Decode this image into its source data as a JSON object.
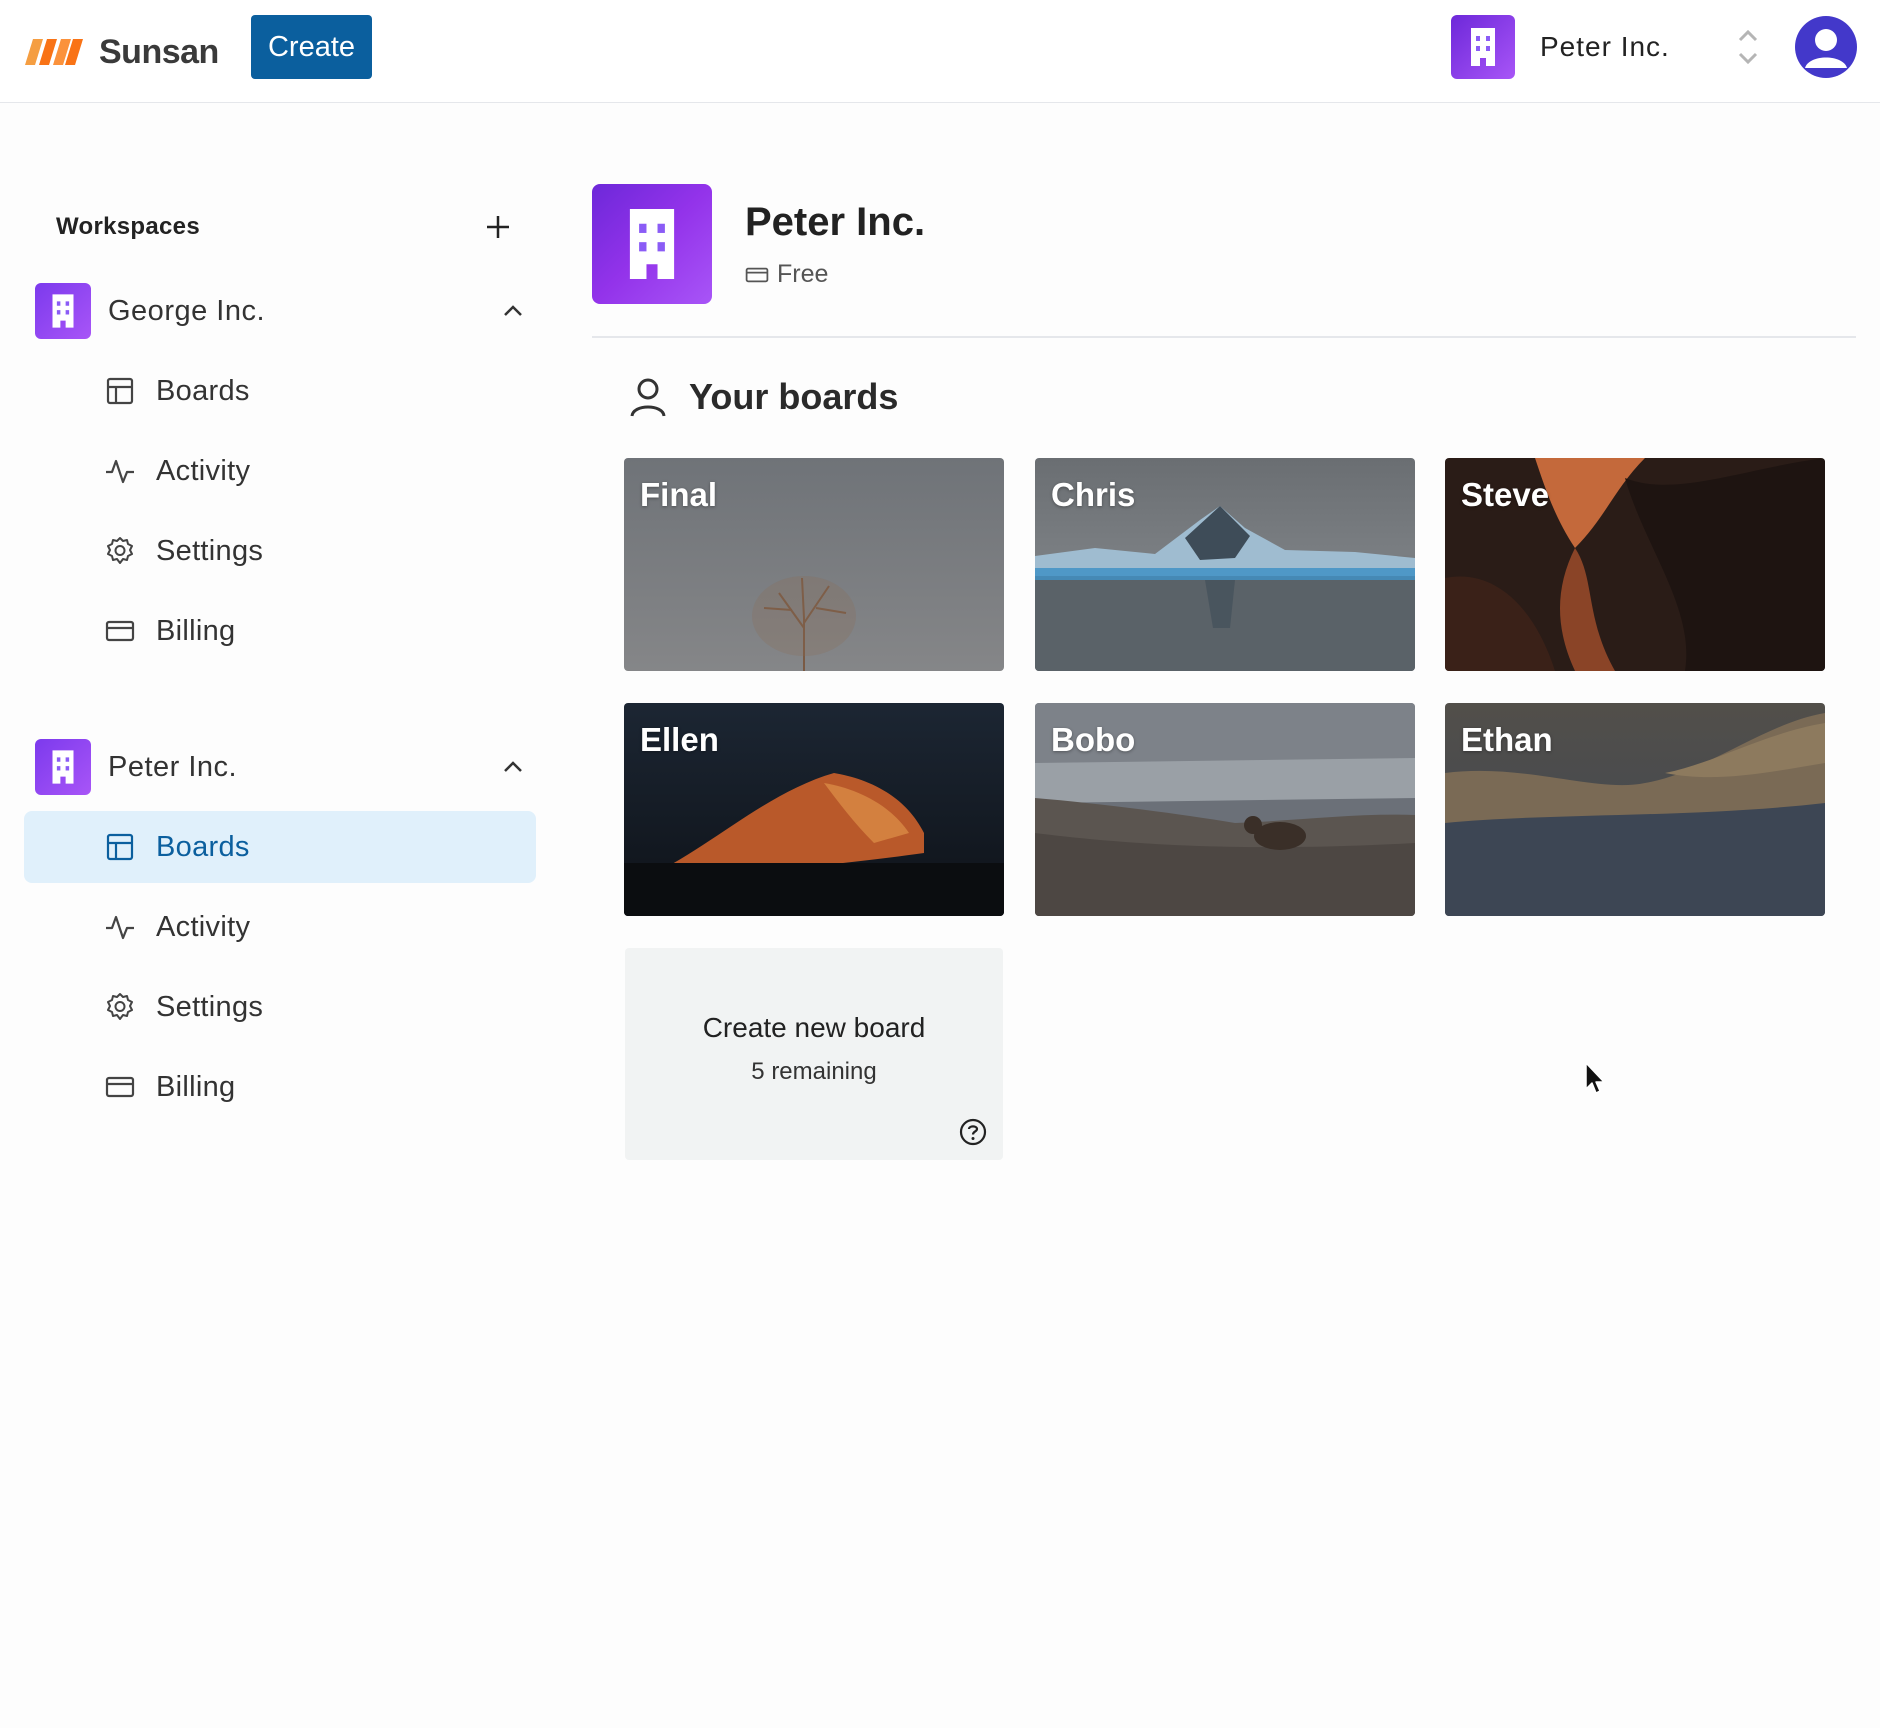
{
  "topnav": {
    "brand": "Sunsan",
    "create_label": "Create",
    "current_org": "Peter Inc."
  },
  "sidebar": {
    "title": "Workspaces",
    "workspaces": [
      {
        "name": "George Inc.",
        "items": [
          {
            "label": "Boards",
            "icon": "boards-icon"
          },
          {
            "label": "Activity",
            "icon": "activity-icon"
          },
          {
            "label": "Settings",
            "icon": "gear-icon"
          },
          {
            "label": "Billing",
            "icon": "credit-card-icon"
          }
        ]
      },
      {
        "name": "Peter Inc.",
        "items": [
          {
            "label": "Boards",
            "icon": "boards-icon",
            "active": true
          },
          {
            "label": "Activity",
            "icon": "activity-icon"
          },
          {
            "label": "Settings",
            "icon": "gear-icon"
          },
          {
            "label": "Billing",
            "icon": "credit-card-icon"
          }
        ]
      }
    ]
  },
  "main": {
    "org_name": "Peter Inc.",
    "plan": "Free",
    "section_title": "Your boards",
    "boards": [
      {
        "title": "Final"
      },
      {
        "title": "Chris"
      },
      {
        "title": "Steve"
      },
      {
        "title": "Ellen"
      },
      {
        "title": "Bobo"
      },
      {
        "title": "Ethan"
      }
    ],
    "new_board": {
      "title": "Create new board",
      "remaining": "5 remaining"
    }
  },
  "colors": {
    "brand_blue": "#0b5f9e",
    "org_purple": "#7c3aed",
    "active_bg": "#e0f0fb"
  }
}
